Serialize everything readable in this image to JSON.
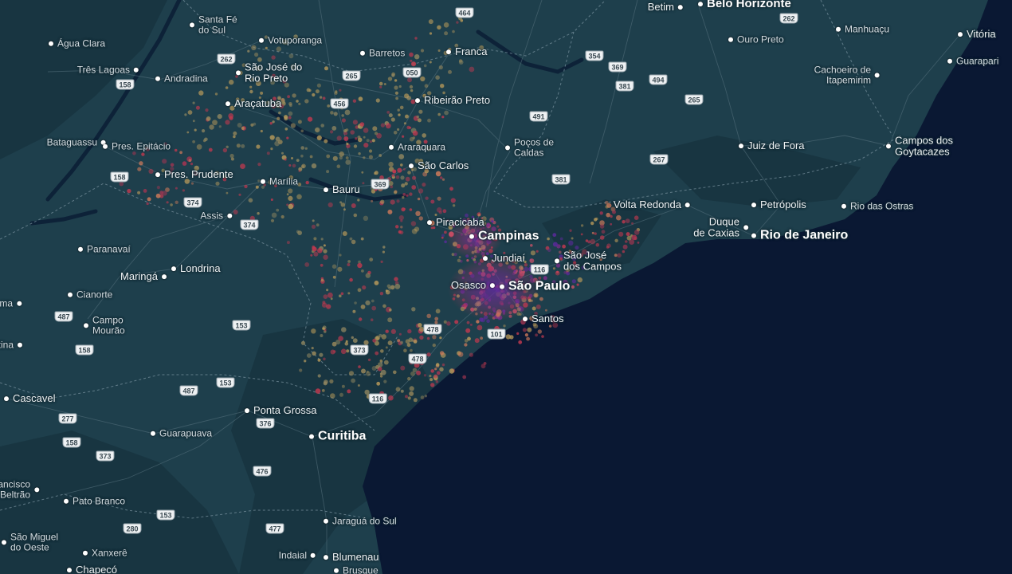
{
  "map": {
    "colors": {
      "land": "#1e3f4c",
      "land_dark": "#183541",
      "ocean": "#0a1833",
      "water": "#0d2238",
      "border": "#7d96a3",
      "heat_low": "#b89a5a",
      "heat_mid": "#c0394f",
      "heat_high": "#5d2a9e"
    },
    "cities": [
      {
        "name": "Belo Horizonte",
        "tier": "lg"
      },
      {
        "name": "Betim",
        "tier": "md"
      },
      {
        "name": "Vitória",
        "tier": "md"
      },
      {
        "name": "Guarapari",
        "tier": "sm"
      },
      {
        "name": "Manhuaçu",
        "tier": "sm"
      },
      {
        "name": "Ouro Preto",
        "tier": "sm"
      },
      {
        "name": "Cachoeiro de\nItapemirim",
        "tier": "sm"
      },
      {
        "name": "Campos dos\nGoytacazes",
        "tier": "md"
      },
      {
        "name": "Juiz de Fora",
        "tier": "md"
      },
      {
        "name": "Petrópolis",
        "tier": "md"
      },
      {
        "name": "Rio das Ostras",
        "tier": "sm"
      },
      {
        "name": "Rio de Janeiro",
        "tier": "xl"
      },
      {
        "name": "Duque\nde Caxias",
        "tier": "md"
      },
      {
        "name": "Volta Redonda",
        "tier": "md"
      },
      {
        "name": "São José\ndos Campos",
        "tier": "md"
      },
      {
        "name": "São Paulo",
        "tier": "xl"
      },
      {
        "name": "Osasco",
        "tier": "md"
      },
      {
        "name": "Santos",
        "tier": "md"
      },
      {
        "name": "Jundiaí",
        "tier": "md"
      },
      {
        "name": "Campinas",
        "tier": "xl"
      },
      {
        "name": "Piracicaba",
        "tier": "md"
      },
      {
        "name": "Poços de\nCaldas",
        "tier": "sm"
      },
      {
        "name": "São Carlos",
        "tier": "md"
      },
      {
        "name": "Araraquara",
        "tier": "sm"
      },
      {
        "name": "Ribeirão Preto",
        "tier": "md"
      },
      {
        "name": "Franca",
        "tier": "md"
      },
      {
        "name": "Barretos",
        "tier": "sm"
      },
      {
        "name": "Votuporanga",
        "tier": "sm"
      },
      {
        "name": "São José do\nRio Preto",
        "tier": "md"
      },
      {
        "name": "Santa Fé\ndo Sul",
        "tier": "sm"
      },
      {
        "name": "Água Clara",
        "tier": "sm"
      },
      {
        "name": "Três Lagoas",
        "tier": "sm"
      },
      {
        "name": "Andradina",
        "tier": "sm"
      },
      {
        "name": "Araçatuba",
        "tier": "md"
      },
      {
        "name": "Bataguassu",
        "tier": "sm"
      },
      {
        "name": "Pres. Epitácio",
        "tier": "sm"
      },
      {
        "name": "Pres. Prudente",
        "tier": "md"
      },
      {
        "name": "Marília",
        "tier": "sm"
      },
      {
        "name": "Bauru",
        "tier": "md"
      },
      {
        "name": "Assis",
        "tier": "sm"
      },
      {
        "name": "Paranavaí",
        "tier": "sm"
      },
      {
        "name": "Londrina",
        "tier": "md"
      },
      {
        "name": "Maringá",
        "tier": "md"
      },
      {
        "name": "Cianorte",
        "tier": "sm"
      },
      {
        "name": "ma",
        "tier": "sm"
      },
      {
        "name": "Campo\nMourão",
        "tier": "sm"
      },
      {
        "name": "otina",
        "tier": "sm"
      },
      {
        "name": "Cascavel",
        "tier": "md"
      },
      {
        "name": "Guarapuava",
        "tier": "sm"
      },
      {
        "name": "Ponta Grossa",
        "tier": "md"
      },
      {
        "name": "Curitiba",
        "tier": "xl"
      },
      {
        "name": "ancisco\nBeltrão",
        "tier": "sm"
      },
      {
        "name": "Pato Branco",
        "tier": "sm"
      },
      {
        "name": "São Miguel\ndo Oeste",
        "tier": "sm"
      },
      {
        "name": "Xanxerê",
        "tier": "sm"
      },
      {
        "name": "Chapecó",
        "tier": "md"
      },
      {
        "name": "Jaraguá do Sul",
        "tier": "sm"
      },
      {
        "name": "Indaial",
        "tier": "sm"
      },
      {
        "name": "Blumenau",
        "tier": "md"
      },
      {
        "name": "Brusque",
        "tier": "sm"
      }
    ],
    "highways": [
      "464",
      "262",
      "262",
      "050",
      "354",
      "369",
      "381",
      "494",
      "265",
      "456",
      "491",
      "265",
      "267",
      "158",
      "369",
      "381",
      "158",
      "374",
      "374",
      "116",
      "487",
      "153",
      "158",
      "478",
      "373",
      "101",
      "478",
      "487",
      "153",
      "116",
      "277",
      "376",
      "158",
      "373",
      "476",
      "153",
      "280",
      "477"
    ]
  }
}
